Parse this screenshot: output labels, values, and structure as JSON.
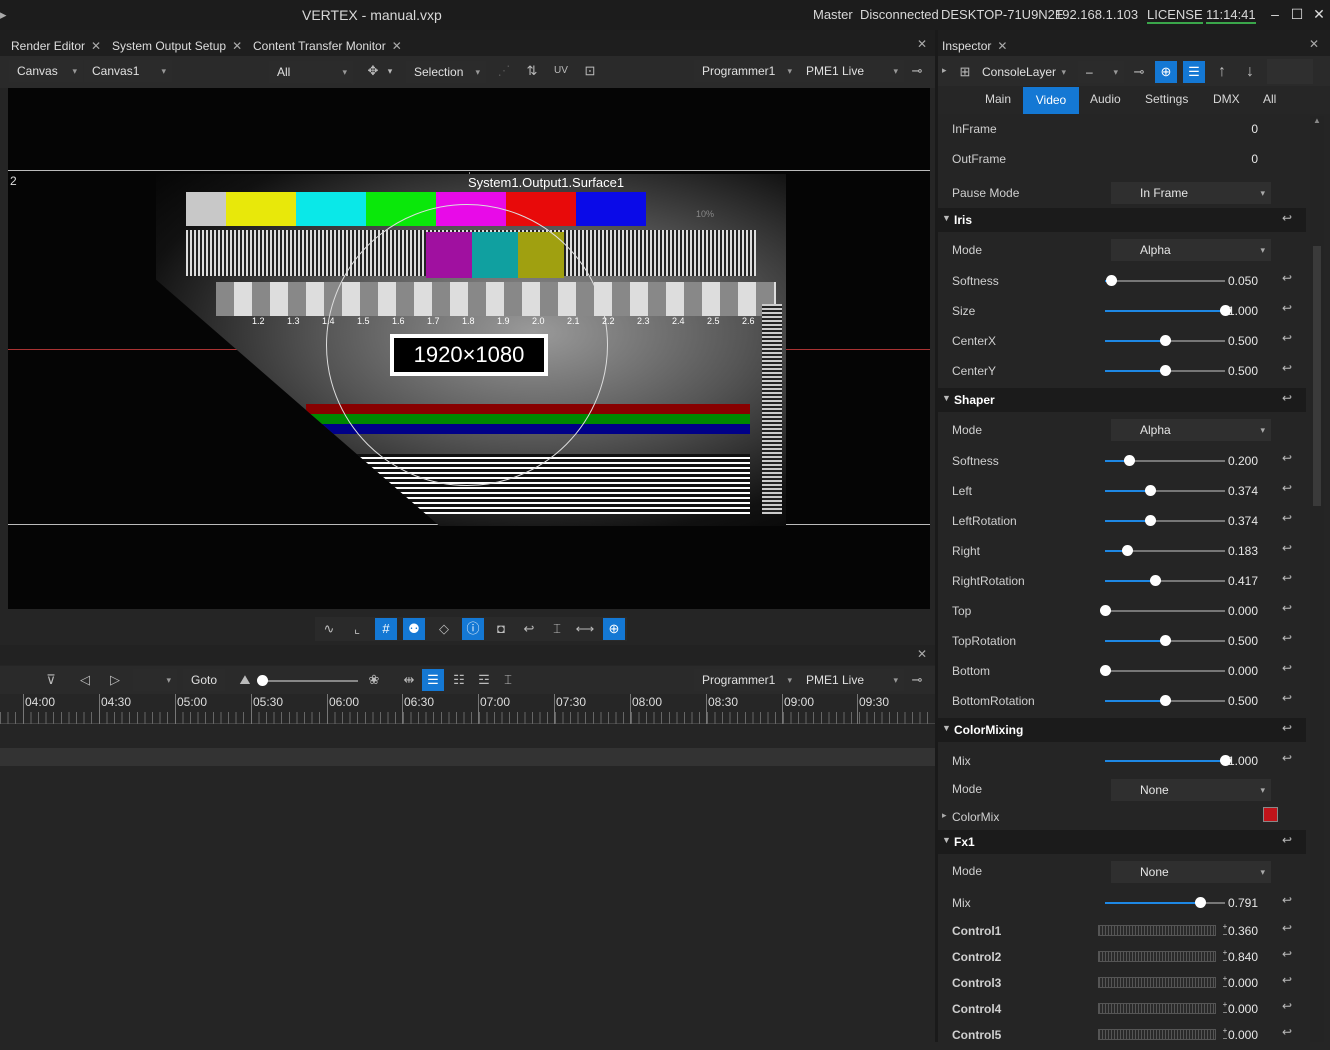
{
  "titlebar": {
    "title": "VERTEX - manual.vxp",
    "mode": "Master",
    "status": "Disconnected",
    "host": "DESKTOP-71U9N2E",
    "ip": "192.168.1.103",
    "license": "LICENSE",
    "time": "11:14:41"
  },
  "left_tabs": [
    "Render Editor",
    "System Output Setup",
    "Content Transfer Monitor"
  ],
  "inspector_tab": "Inspector",
  "toolbar": {
    "canvas_label": "Canvas",
    "canvas_value": "Canvas1",
    "filter": "All",
    "selection": "Selection",
    "programmer": "Programmer1",
    "pme": "PME1 Live"
  },
  "viewport": {
    "surface_label": "System1.Output1.Surface1",
    "resolution": "1920×1080",
    "corner_label": "2",
    "scale_ticks": [
      "1.2",
      "1.3",
      "1.4",
      "1.5",
      "1.6",
      "1.7",
      "1.8",
      "1.9",
      "2.0",
      "2.1",
      "2.2",
      "2.3",
      "2.4",
      "2.5",
      "2.6"
    ],
    "marker": "10%"
  },
  "timeline": {
    "goto": "Goto",
    "programmer": "Programmer1",
    "pme": "PME1 Live",
    "times": [
      "04:00",
      "04:30",
      "05:00",
      "05:30",
      "06:00",
      "06:30",
      "07:00",
      "07:30",
      "08:00",
      "08:30",
      "09:00",
      "09:30"
    ]
  },
  "inspector": {
    "layer": "ConsoleLayer",
    "layer_extra": "–",
    "tabs": [
      "Main",
      "Video",
      "Audio",
      "Settings",
      "DMX",
      "All"
    ],
    "active_tab": "Video",
    "inframe": {
      "label": "InFrame",
      "value": "0"
    },
    "outframe": {
      "label": "OutFrame",
      "value": "0"
    },
    "pause": {
      "label": "Pause Mode",
      "value": "In Frame"
    },
    "iris": {
      "title": "Iris",
      "mode_label": "Mode",
      "mode": "Alpha",
      "sliders": [
        {
          "label": "Softness",
          "value": "0.050",
          "frac": 0.05
        },
        {
          "label": "Size",
          "value": "1.000",
          "frac": 1.0
        },
        {
          "label": "CenterX",
          "value": "0.500",
          "frac": 0.5
        },
        {
          "label": "CenterY",
          "value": "0.500",
          "frac": 0.5
        }
      ]
    },
    "shaper": {
      "title": "Shaper",
      "mode_label": "Mode",
      "mode": "Alpha",
      "sliders": [
        {
          "label": "Softness",
          "value": "0.200",
          "frac": 0.2
        },
        {
          "label": "Left",
          "value": "0.374",
          "frac": 0.374
        },
        {
          "label": "LeftRotation",
          "value": "0.374",
          "frac": 0.374
        },
        {
          "label": "Right",
          "value": "0.183",
          "frac": 0.183
        },
        {
          "label": "RightRotation",
          "value": "0.417",
          "frac": 0.417
        },
        {
          "label": "Top",
          "value": "0.000",
          "frac": 0.0
        },
        {
          "label": "TopRotation",
          "value": "0.500",
          "frac": 0.5
        },
        {
          "label": "Bottom",
          "value": "0.000",
          "frac": 0.0
        },
        {
          "label": "BottomRotation",
          "value": "0.500",
          "frac": 0.5
        }
      ]
    },
    "colormixing": {
      "title": "ColorMixing",
      "mix_label": "Mix",
      "mix": "1.000",
      "mix_frac": 1.0,
      "mode_label": "Mode",
      "mode": "None",
      "colormix_label": "ColorMix",
      "colormix_color": "#c0141a"
    },
    "fx1": {
      "title": "Fx1",
      "mode_label": "Mode",
      "mode": "None",
      "mix_label": "Mix",
      "mix": "0.791",
      "mix_frac": 0.791,
      "controls": [
        {
          "label": "Control1",
          "value": "0.360"
        },
        {
          "label": "Control2",
          "value": "0.840"
        },
        {
          "label": "Control3",
          "value": "0.000"
        },
        {
          "label": "Control4",
          "value": "0.000"
        },
        {
          "label": "Control5",
          "value": "0.000"
        }
      ]
    }
  },
  "colors": {
    "accent": "#1478d4",
    "license_underline": "#3aa64a"
  }
}
